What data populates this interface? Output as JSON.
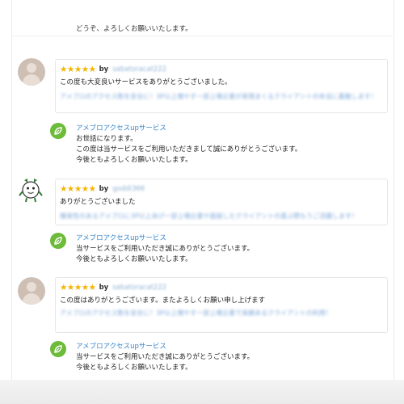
{
  "top_reply": {
    "line": "どうぞ、よろしくお願いいたします。"
  },
  "reviews": [
    {
      "stars": "★★★★★",
      "by": "by",
      "username": "sabatoracat222",
      "comment": "この度も大変良いサービスをありがとうございました。",
      "blurred": "アメブロのアクセス数を安全に！3P以上増やす一部上場企業が実現まくるクライアントの本当に素敵します！",
      "reply": {
        "name": "アメブロアクセスupサービス",
        "lines": [
          "お世話になります。",
          "この度は当サービスをご利用いただきまして誠にありがとうございます。",
          "今後ともよろしくお願いいたします。"
        ]
      }
    },
    {
      "stars": "★★★★★",
      "by": "by",
      "username": "goddi366",
      "comment": "ありがとうございました",
      "blurred": "確実性のあるアメブロに3P以上あげ一部上場企業や面接したクライアントの喜ぶ際もうご活躍します！",
      "reply": {
        "name": "アメブロアクセスupサービス",
        "lines": [
          "当サービスをご利用いただき誠にありがとうございます。",
          "今後ともよろしくお願いいたします。"
        ]
      }
    },
    {
      "stars": "★★★★★",
      "by": "by",
      "username": "sabatoracat222",
      "comment": "この度はありがとうございます。またよろしくお願い申し上げます",
      "blurred": "アメブロのアクセス数を安全に！3P以上増やす一部上場企業で実績あるクライアントの利用！",
      "reply": {
        "name": "アメブロアクセスupサービス",
        "lines": [
          "当サービスをご利用いただき誠にありがとうございます。",
          "今後ともよろしくお願いいたします。"
        ]
      }
    }
  ],
  "colors": {
    "star": "#f4b400",
    "link": "#3a86c8",
    "reply_icon": "#6dbb3a"
  }
}
